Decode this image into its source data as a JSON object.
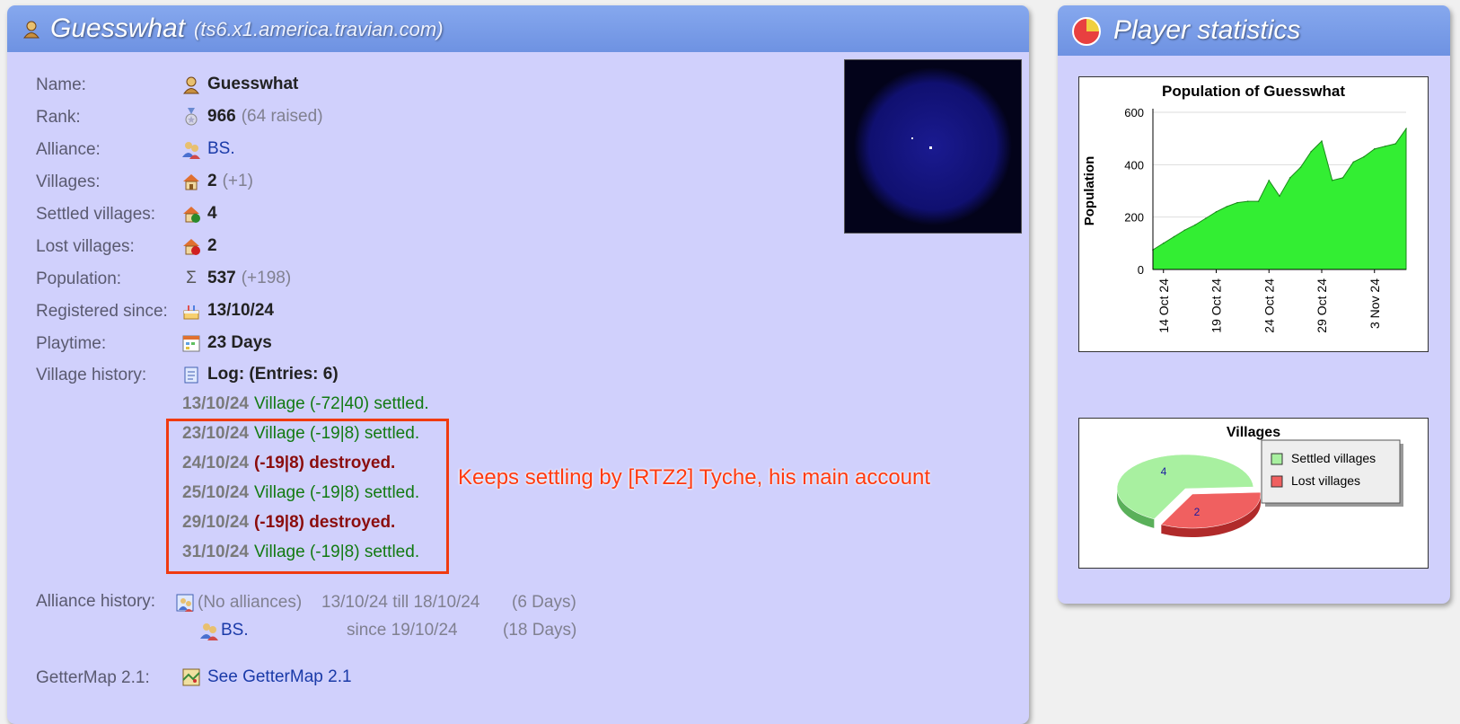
{
  "profile_panel": {
    "player_name": "Guesswhat",
    "server": "(ts6.x1.america.travian.com)",
    "rows": {
      "name": {
        "label": "Name:",
        "value": "Guesswhat"
      },
      "rank": {
        "label": "Rank:",
        "value": "966",
        "extra": "(64 raised)"
      },
      "alliance": {
        "label": "Alliance:",
        "value": "BS."
      },
      "villages": {
        "label": "Villages:",
        "value": "2",
        "extra": "(+1)"
      },
      "settled": {
        "label": "Settled villages:",
        "value": "4"
      },
      "lost": {
        "label": "Lost villages:",
        "value": "2"
      },
      "population": {
        "label": "Population:",
        "value": "537",
        "extra": "(+198)"
      },
      "registered": {
        "label": "Registered since:",
        "value": "13/10/24"
      },
      "playtime": {
        "label": "Playtime:",
        "value": "23 Days"
      },
      "village_history": {
        "label": "Village history:",
        "value": "Log: (Entries: 6)"
      }
    },
    "history": [
      {
        "date": "13/10/24",
        "text": "Village (-72|40) settled.",
        "type": "settled"
      },
      {
        "date": "23/10/24",
        "text": "Village (-19|8) settled.",
        "type": "settled"
      },
      {
        "date": "24/10/24",
        "text": "(-19|8) destroyed.",
        "type": "destroyed"
      },
      {
        "date": "25/10/24",
        "text": "Village (-19|8) settled.",
        "type": "settled"
      },
      {
        "date": "29/10/24",
        "text": "(-19|8) destroyed.",
        "type": "destroyed"
      },
      {
        "date": "31/10/24",
        "text": "Village (-19|8) settled.",
        "type": "settled"
      }
    ],
    "annotation": "Keeps settling by [RTZ2] Tyche, his main account",
    "alliance_history": {
      "label": "Alliance history:",
      "entries": [
        {
          "name": "(No alliances)",
          "period": "13/10/24 till 18/10/24",
          "duration": "(6 Days)"
        },
        {
          "name": "BS.",
          "period": "since 19/10/24",
          "duration": "(18 Days)"
        }
      ]
    },
    "gettermap": {
      "label": "GetterMap 2.1:",
      "link": "See GetterMap 2.1"
    }
  },
  "stats_panel": {
    "title": "Player statistics"
  },
  "chart_data": [
    {
      "type": "area",
      "title": "Population of Guesswhat",
      "xlabel": "",
      "ylabel": "Population",
      "ylim": [
        0,
        600
      ],
      "yticks": [
        0,
        200,
        400,
        600
      ],
      "xticks": [
        "14 Oct 24",
        "19 Oct 24",
        "24 Oct 24",
        "29 Oct 24",
        "3 Nov 24"
      ],
      "x": [
        "13 Oct",
        "14 Oct",
        "15 Oct",
        "16 Oct",
        "17 Oct",
        "18 Oct",
        "19 Oct",
        "20 Oct",
        "21 Oct",
        "22 Oct",
        "23 Oct",
        "24 Oct",
        "25 Oct",
        "26 Oct",
        "27 Oct",
        "28 Oct",
        "29 Oct",
        "30 Oct",
        "31 Oct",
        "1 Nov",
        "2 Nov",
        "3 Nov",
        "4 Nov",
        "5 Nov",
        "6 Nov"
      ],
      "values": [
        75,
        100,
        125,
        150,
        170,
        195,
        220,
        240,
        255,
        260,
        260,
        340,
        280,
        350,
        390,
        450,
        490,
        340,
        350,
        410,
        430,
        460,
        470,
        480,
        537
      ],
      "color": "#33ee33",
      "grid": true
    },
    {
      "type": "pie",
      "title": "Villages",
      "labels": [
        "Settled villages",
        "Lost villages"
      ],
      "values": [
        4,
        2
      ],
      "colors": [
        "#a8f0a0",
        "#f06060"
      ],
      "legend": "right"
    }
  ]
}
